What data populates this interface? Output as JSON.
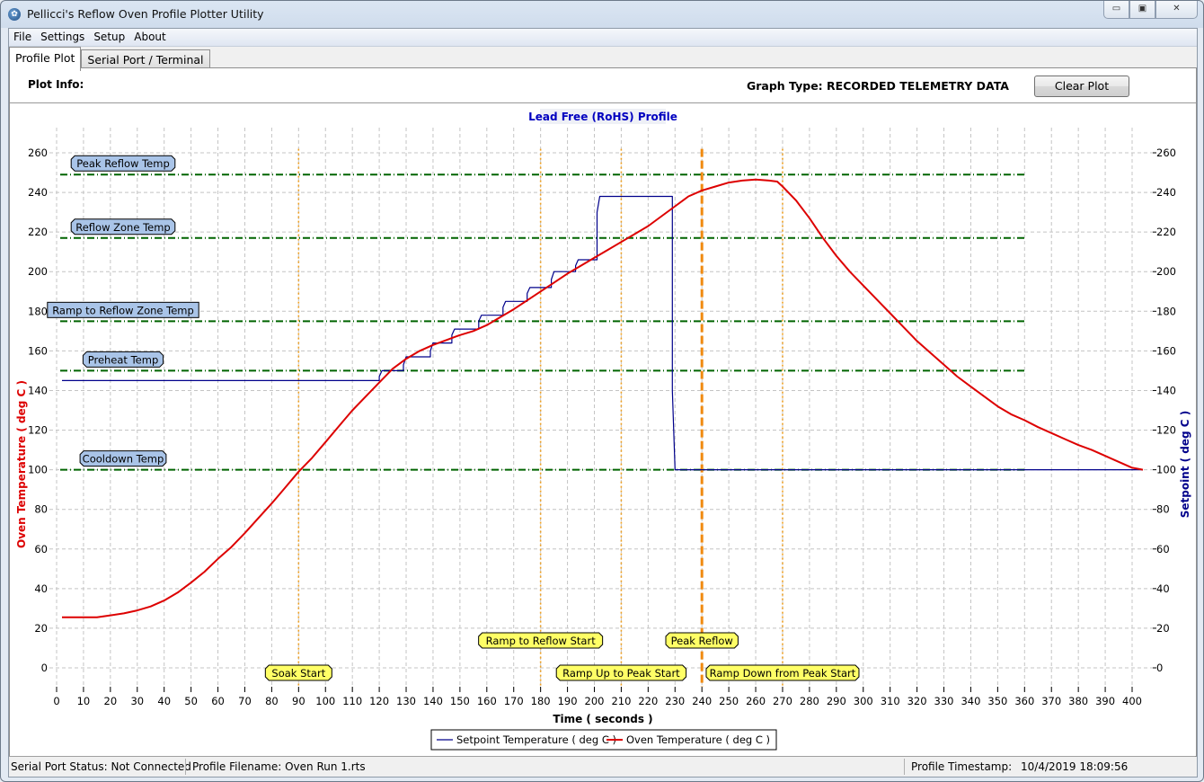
{
  "window": {
    "title": "Pellicci's Reflow Oven Profile Plotter Utility",
    "icon": "paw-icon",
    "controls": [
      "minimize",
      "maximize",
      "close"
    ]
  },
  "menu": [
    "File",
    "Settings",
    "Setup",
    "About"
  ],
  "tabs": [
    {
      "label": "Profile Plot",
      "active": true
    },
    {
      "label": "Serial Port / Terminal",
      "active": false
    }
  ],
  "info": {
    "plot_info_label": "Plot Info:",
    "graph_type": "Graph Type: RECORDED TELEMETRY DATA",
    "clear_button": "Clear Plot"
  },
  "status": {
    "serial": "Serial Port Status: Not Connected",
    "filename": "Profile Filename: Oven Run 1.rts",
    "timestamp_label": "Profile Timestamp:",
    "timestamp_value": "10/4/2019 18:09:56"
  },
  "colors": {
    "oven": "#dd0000",
    "setpoint": "#00008b",
    "threshold": "#006400",
    "event": "#f0a020",
    "peak_event": "#f08a10",
    "temp_label_bg": "#a9c4e8",
    "event_label_bg": "#ffff66",
    "title_color": "#0000c0"
  },
  "chart_data": {
    "type": "line",
    "title": "Lead Free (RoHS) Profile",
    "xlabel": "Time ( seconds )",
    "ylabel": "Oven Temperature ( deg C )",
    "y2label": "Setpoint ( deg C )",
    "xlim": [
      0,
      400
    ],
    "ylim": [
      0,
      260
    ],
    "xticks": [
      0,
      10,
      20,
      30,
      40,
      50,
      60,
      70,
      80,
      90,
      100,
      110,
      120,
      130,
      140,
      150,
      160,
      170,
      180,
      190,
      200,
      210,
      220,
      230,
      240,
      250,
      260,
      270,
      280,
      290,
      300,
      310,
      320,
      330,
      340,
      350,
      360,
      370,
      380,
      390,
      400
    ],
    "yticks": [
      0,
      20,
      40,
      60,
      80,
      100,
      120,
      140,
      160,
      180,
      200,
      220,
      240,
      260
    ],
    "y2ticks": [
      0,
      20,
      40,
      60,
      80,
      100,
      120,
      140,
      160,
      180,
      200,
      220,
      240,
      260
    ],
    "grid": true,
    "legend_position": "bottom-center",
    "series": [
      {
        "name": "Setpoint Temperature ( deg C )",
        "color": "#00008b",
        "x": [
          2,
          120,
          120,
          121,
          129,
          129,
          130,
          139,
          139,
          140,
          147,
          147,
          148,
          157,
          157,
          158,
          166,
          166,
          167,
          175,
          175,
          176,
          184,
          184,
          185,
          193,
          193,
          194,
          201,
          201,
          202,
          229,
          229,
          230,
          404
        ],
        "y": [
          145,
          145,
          147,
          150,
          150,
          153,
          157,
          157,
          160,
          164,
          164,
          168,
          171,
          171,
          175,
          178,
          178,
          182,
          185,
          185,
          189,
          192,
          192,
          196,
          200,
          200,
          203,
          206,
          206,
          230,
          238,
          238,
          140,
          100,
          100
        ]
      },
      {
        "name": "Oven Temperature ( deg C )",
        "color": "#dd0000",
        "x": [
          2,
          10,
          15,
          20,
          25,
          30,
          35,
          40,
          45,
          50,
          55,
          60,
          65,
          70,
          75,
          80,
          85,
          90,
          95,
          100,
          105,
          110,
          115,
          120,
          125,
          130,
          135,
          140,
          145,
          150,
          155,
          160,
          165,
          170,
          175,
          180,
          185,
          190,
          195,
          200,
          205,
          210,
          215,
          220,
          225,
          230,
          235,
          240,
          245,
          250,
          255,
          260,
          265,
          268,
          270,
          275,
          280,
          285,
          290,
          295,
          300,
          305,
          310,
          315,
          320,
          325,
          330,
          335,
          340,
          345,
          350,
          355,
          360,
          365,
          370,
          375,
          380,
          385,
          390,
          395,
          400,
          404
        ],
        "y": [
          25.5,
          25.5,
          25.5,
          26.5,
          27.5,
          29,
          31,
          34,
          38,
          43,
          48.5,
          55,
          61,
          68,
          75.5,
          83,
          91,
          99,
          106,
          114,
          122,
          130,
          137,
          144,
          151,
          156,
          160,
          163,
          165.5,
          168,
          170,
          173,
          177,
          181,
          185.5,
          190,
          194.5,
          199,
          203,
          207,
          211,
          215,
          219,
          223,
          228,
          233,
          238,
          241,
          243,
          245,
          246,
          246.5,
          246,
          245.5,
          243,
          236,
          227,
          217,
          208,
          200,
          193,
          186,
          179,
          172,
          165,
          159,
          153,
          147,
          142,
          137,
          132,
          128,
          125,
          121.5,
          118.5,
          115.5,
          112.5,
          110,
          107,
          104,
          101,
          100
        ]
      }
    ],
    "threshold_lines": [
      {
        "label": "Peak Reflow Temp",
        "value": 249
      },
      {
        "label": "Reflow Zone Temp",
        "value": 217
      },
      {
        "label": "Ramp to Reflow Zone Temp",
        "value": 175
      },
      {
        "label": "Preheat Temp",
        "value": 150
      },
      {
        "label": "Cooldown Temp",
        "value": 100
      }
    ],
    "threshold_xrange": [
      0,
      360
    ],
    "event_lines": [
      {
        "label": "Soak Start",
        "t": 90,
        "row": 2
      },
      {
        "label": "Ramp to Reflow Start",
        "t": 180,
        "row": 1
      },
      {
        "label": "Ramp Up to Peak Start",
        "t": 210,
        "row": 2
      },
      {
        "label": "Peak Reflow",
        "t": 240,
        "row": 1,
        "emphasis": true
      },
      {
        "label": "Ramp Down from Peak Start",
        "t": 270,
        "row": 2
      }
    ]
  }
}
